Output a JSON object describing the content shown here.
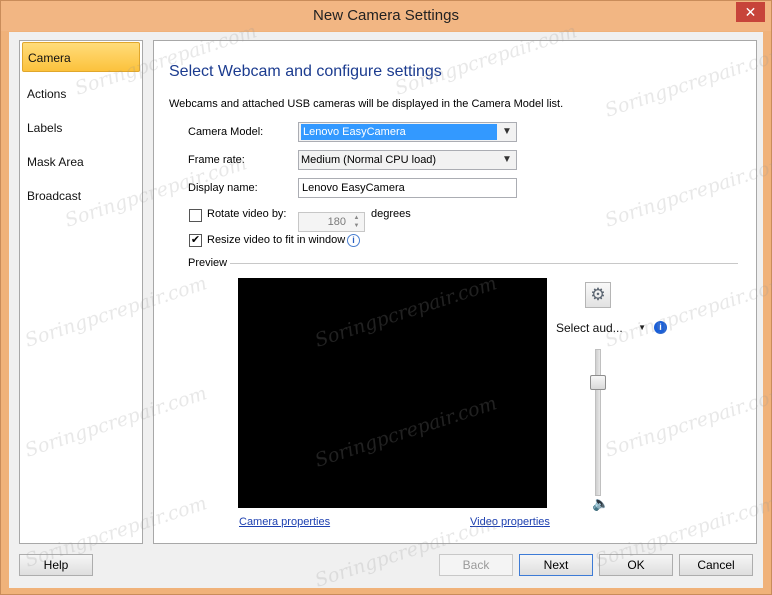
{
  "window": {
    "title": "New Camera Settings",
    "close_glyph": "✕"
  },
  "sidebar": {
    "items": [
      {
        "label": "Camera",
        "active": true
      },
      {
        "label": "Actions",
        "active": false
      },
      {
        "label": "Labels",
        "active": false
      },
      {
        "label": "Mask Area",
        "active": false
      },
      {
        "label": "Broadcast",
        "active": false
      }
    ]
  },
  "main": {
    "heading": "Select Webcam and configure settings",
    "description": "Webcams and attached USB cameras will be displayed in the Camera Model list.",
    "camera_model": {
      "label": "Camera Model:",
      "value": "Lenovo EasyCamera"
    },
    "frame_rate": {
      "label": "Frame rate:",
      "value": "Medium (Normal CPU load)"
    },
    "display_name": {
      "label": "Display name:",
      "value": "Lenovo EasyCamera"
    },
    "rotate": {
      "label": "Rotate video by:",
      "checked": false,
      "value": "180",
      "unit": "degrees"
    },
    "resize": {
      "label": "Resize video to fit in window",
      "checked": true,
      "check_glyph": "✔"
    },
    "preview": {
      "label": "Preview",
      "camera_properties": "Camera properties",
      "video_properties": "Video properties",
      "audio_select": "Select aud...",
      "audio_level": 0.8
    }
  },
  "buttons": {
    "help": "Help",
    "back": "Back",
    "next": "Next",
    "ok": "OK",
    "cancel": "Cancel"
  },
  "watermark_text": "Soringpcrepair.com",
  "colors": {
    "window_frame": "#f0b27a",
    "heading": "#1b3b8f",
    "selection": "#3399ff",
    "active_tab": "#fcc23c",
    "link": "#1c3fb0"
  }
}
